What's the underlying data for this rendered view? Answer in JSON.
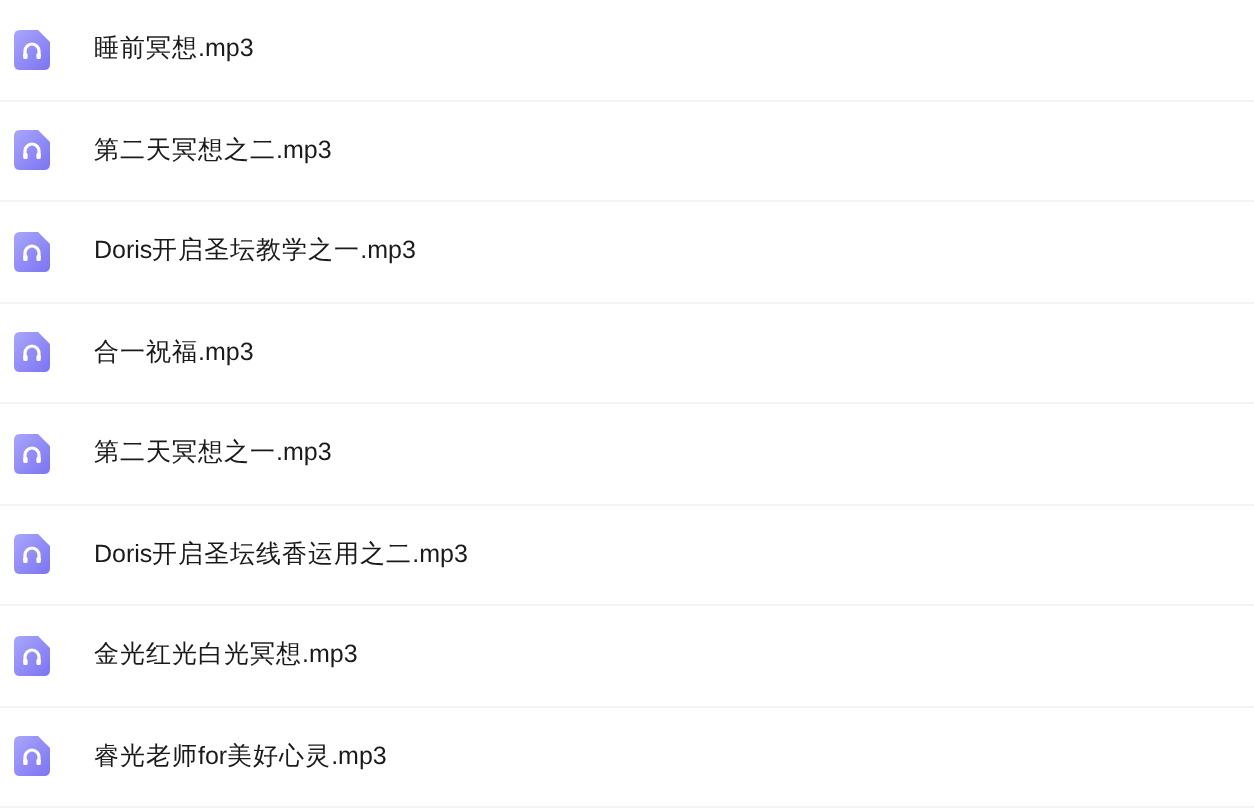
{
  "files": [
    {
      "name": "睡前冥想.mp3"
    },
    {
      "name": "第二天冥想之二.mp3"
    },
    {
      "name": "Doris开启圣坛教学之一.mp3"
    },
    {
      "name": "合一祝福.mp3"
    },
    {
      "name": "第二天冥想之一.mp3"
    },
    {
      "name": "Doris开启圣坛线香运用之二.mp3"
    },
    {
      "name": "金光红光白光冥想.mp3"
    },
    {
      "name": "睿光老师for美好心灵.mp3"
    }
  ]
}
